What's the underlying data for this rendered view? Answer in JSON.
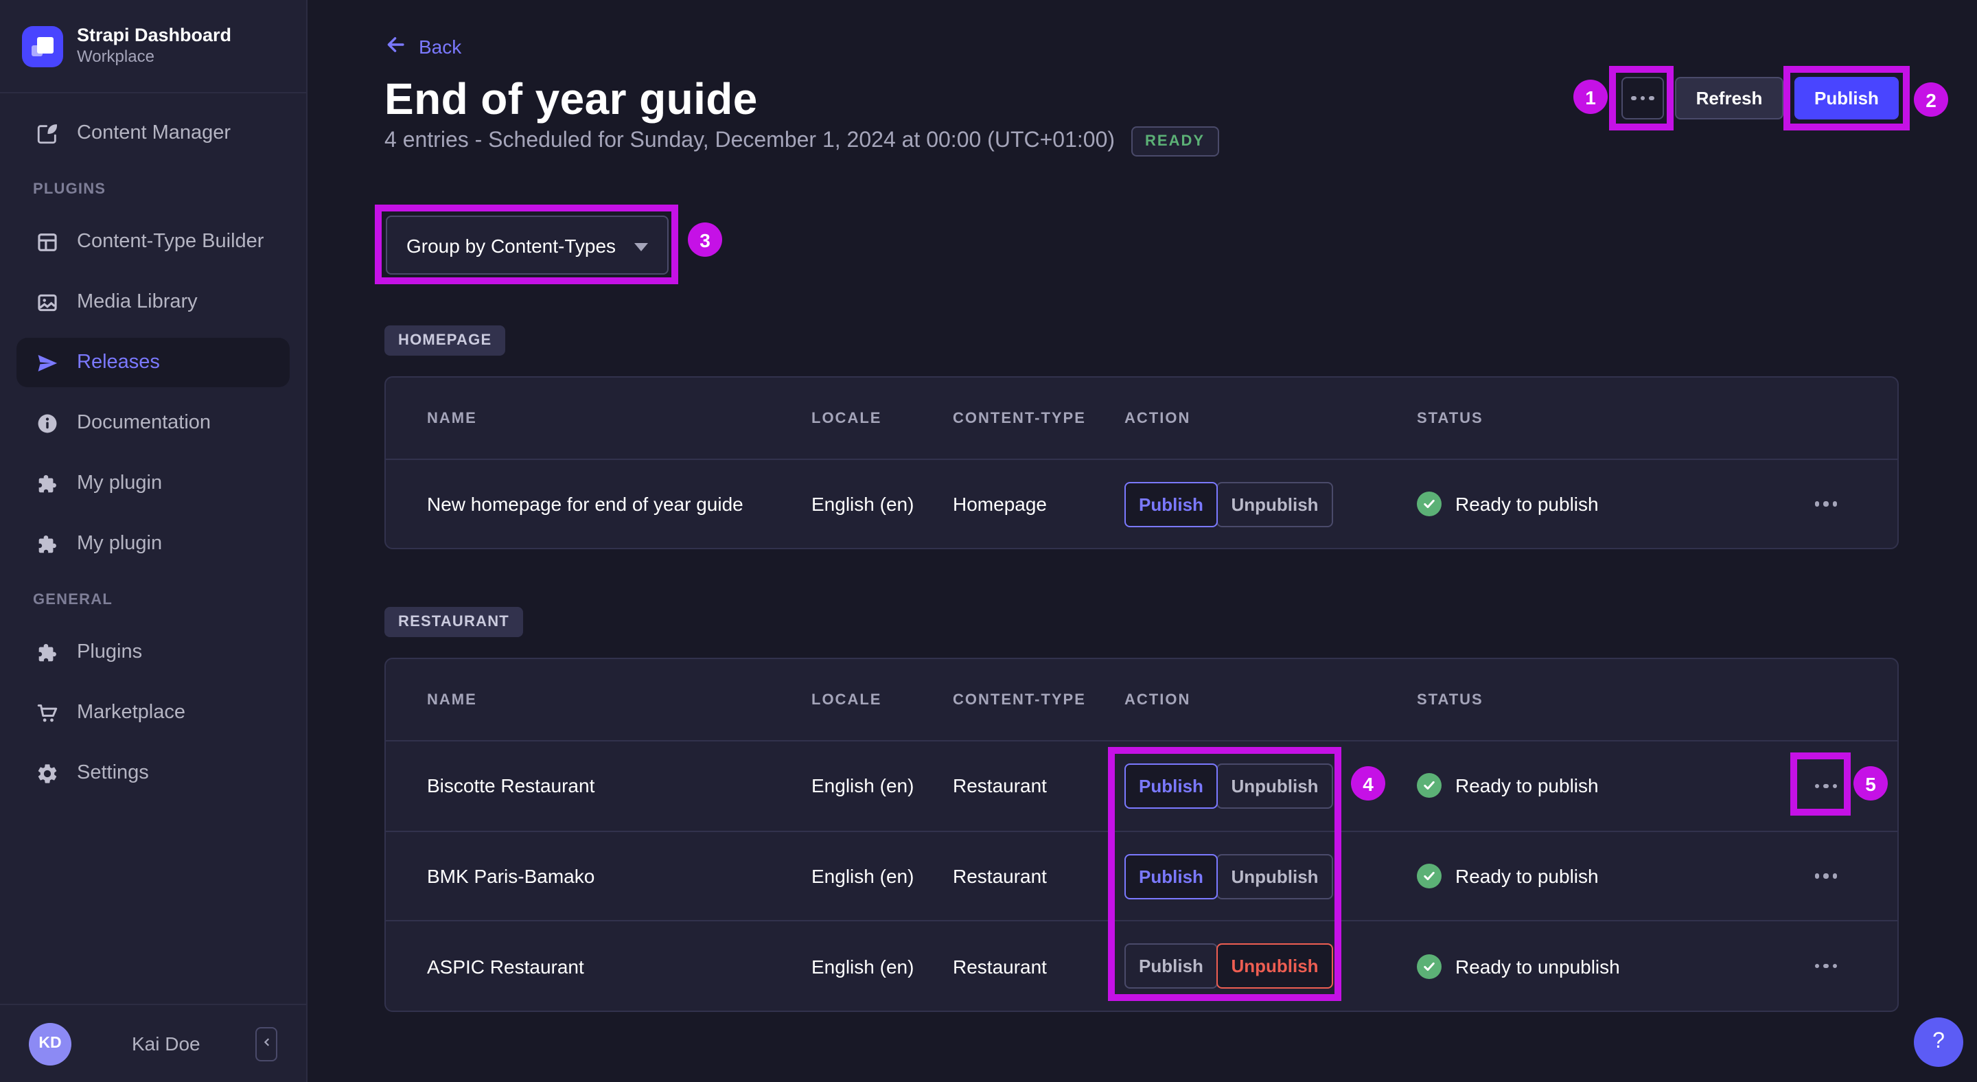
{
  "colors": {
    "accent": "#4945ff",
    "purple": "#7b79ff",
    "success": "#5cb176",
    "danger": "#ee5e52",
    "annotation": "#c511e6"
  },
  "sidebar": {
    "brand": {
      "title": "Strapi Dashboard",
      "subtitle": "Workplace"
    },
    "content_manager": {
      "label": "Content Manager"
    },
    "sections": [
      {
        "label": "PLUGINS",
        "items": [
          {
            "label": "Content-Type Builder"
          },
          {
            "label": "Media Library"
          },
          {
            "label": "Releases",
            "active": true
          },
          {
            "label": "Documentation"
          },
          {
            "label": "My plugin"
          },
          {
            "label": "My plugin"
          }
        ]
      },
      {
        "label": "GENERAL",
        "items": [
          {
            "label": "Plugins"
          },
          {
            "label": "Marketplace"
          },
          {
            "label": "Settings"
          }
        ]
      }
    ],
    "footer": {
      "avatar_initials": "KD",
      "user_name": "Kai Doe"
    }
  },
  "header": {
    "back_label": "Back",
    "title": "End of year guide",
    "subtitle": "4 entries - Scheduled for Sunday, December 1, 2024 at 00:00 (UTC+01:00)",
    "status_badge": "READY",
    "refresh_label": "Refresh",
    "publish_label": "Publish"
  },
  "toolbar": {
    "group_by_label": "Group by Content-Types"
  },
  "table": {
    "columns": [
      "NAME",
      "LOCALE",
      "CONTENT-TYPE",
      "ACTION",
      "STATUS"
    ],
    "action_labels": {
      "publish": "Publish",
      "unpublish": "Unpublish"
    }
  },
  "groups": [
    {
      "tag": "HOMEPAGE",
      "rows": [
        {
          "name": "New homepage for end of year guide",
          "locale": "English (en)",
          "content_type": "Homepage",
          "selected_action": "publish",
          "status": "Ready to publish"
        }
      ]
    },
    {
      "tag": "RESTAURANT",
      "rows": [
        {
          "name": "Biscotte Restaurant",
          "locale": "English (en)",
          "content_type": "Restaurant",
          "selected_action": "publish",
          "status": "Ready to publish"
        },
        {
          "name": "BMK Paris-Bamako",
          "locale": "English (en)",
          "content_type": "Restaurant",
          "selected_action": "publish",
          "status": "Ready to publish"
        },
        {
          "name": "ASPIC Restaurant",
          "locale": "English (en)",
          "content_type": "Restaurant",
          "selected_action": "unpublish",
          "status": "Ready to unpublish"
        }
      ]
    }
  ],
  "annotations": {
    "n1": "1",
    "n2": "2",
    "n3": "3",
    "n4": "4",
    "n5": "5"
  },
  "help_label": "?"
}
